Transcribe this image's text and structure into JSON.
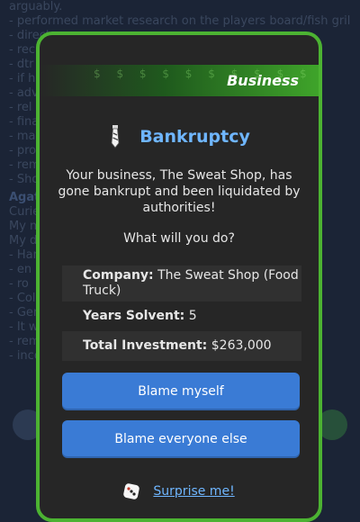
{
  "background": {
    "lines": [
      "arguably.",
      "- performed market research on the players board/fish grilled",
      "- direct",
      "- rec",
      "- dtr",
      "- if ha",
      "- adv",
      "- rel",
      "- fina",
      "- mat",
      "- prod",
      "- remo",
      "- Shop"
    ],
    "heading": "Agat",
    "lines2": [
      "Curie",
      "My m",
      "My d",
      "- Hand",
      "- en a",
      "- ro",
      "- Colle",
      "- Gent",
      "- It wa",
      "- rema",
      "- inco"
    ]
  },
  "modal": {
    "category": "Business",
    "banner_pattern": "$ $ $ $ $ $ $ $ $ $ $ $ $ $ $ $ $ $ $ $",
    "icon": "tie-icon",
    "title": "Bankruptcy",
    "message": "Your business, The Sweat Shop, has gone bankrupt and been liquidated by authorities!",
    "question": "What will you do?",
    "details": [
      {
        "label": "Company:",
        "value": "The Sweat Shop (Food Truck)"
      },
      {
        "label": "Years Solvent:",
        "value": "5"
      },
      {
        "label": "Total Investment:",
        "value": "$263,000"
      }
    ],
    "buttons": {
      "blame_myself": "Blame myself",
      "blame_others": "Blame everyone else"
    },
    "surprise": "Surprise me!"
  },
  "colors": {
    "accent_green": "#4cb332",
    "button_blue": "#3a7bd5",
    "title_blue": "#6fb6ff",
    "modal_bg": "#262626"
  }
}
